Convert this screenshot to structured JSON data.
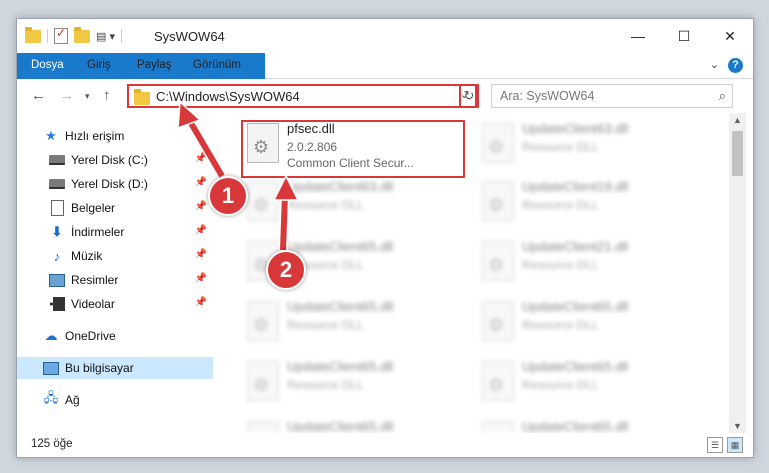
{
  "window": {
    "title": "SysWOW64",
    "min": "—",
    "max": "☐",
    "close": "✕"
  },
  "ribbon": {
    "tabs": [
      "Dosya",
      "Giriş",
      "Paylaş",
      "Görünüm"
    ],
    "help": "?",
    "expand": "⌄"
  },
  "address": {
    "path": "C:\\Windows\\SysWOW64",
    "search_placeholder": "Ara: SysWOW64"
  },
  "nav": {
    "items": [
      {
        "label": "Hızlı erişim"
      },
      {
        "label": "Yerel Disk (C:)"
      },
      {
        "label": "Yerel Disk (D:)"
      },
      {
        "label": "Belgeler"
      },
      {
        "label": "İndirmeler"
      },
      {
        "label": "Müzik"
      },
      {
        "label": "Resimler"
      },
      {
        "label": "Videolar"
      },
      {
        "label": "OneDrive"
      },
      {
        "label": "Bu bilgisayar"
      },
      {
        "label": "Ağ"
      }
    ]
  },
  "files": {
    "selected": {
      "name": "pfsec.dll",
      "version": "2.0.2.806",
      "desc": "Common Client Secur..."
    },
    "blurred": [
      {
        "name": "UpdateClient63.dll",
        "desc": "Resource DLL"
      },
      {
        "name": "UpdateClient63.dll",
        "desc": "Resource DLL"
      },
      {
        "name": "UpdateClient19.dll",
        "desc": "Resource DLL"
      },
      {
        "name": "UpdateClient65.dll",
        "desc": "Resource DLL"
      },
      {
        "name": "UpdateClient21.dll",
        "desc": "Resource DLL"
      },
      {
        "name": "UpdateClient65.dll",
        "desc": "Resource DLL"
      },
      {
        "name": "UpdateClient65.dll",
        "desc": "Resource DLL"
      },
      {
        "name": "UpdateClient65.dll",
        "desc": "Resource DLL"
      },
      {
        "name": "UpdateClient65.dll",
        "desc": "Resource DLL"
      },
      {
        "name": "UpdateClient65.dll",
        "desc": "Resource DLL"
      },
      {
        "name": "UpdateClient65.dll",
        "desc": "Resource DLL"
      }
    ]
  },
  "status": {
    "count": "125 öğe"
  },
  "annotations": {
    "badge1": "1",
    "badge2": "2",
    "color": "#d9383a"
  }
}
